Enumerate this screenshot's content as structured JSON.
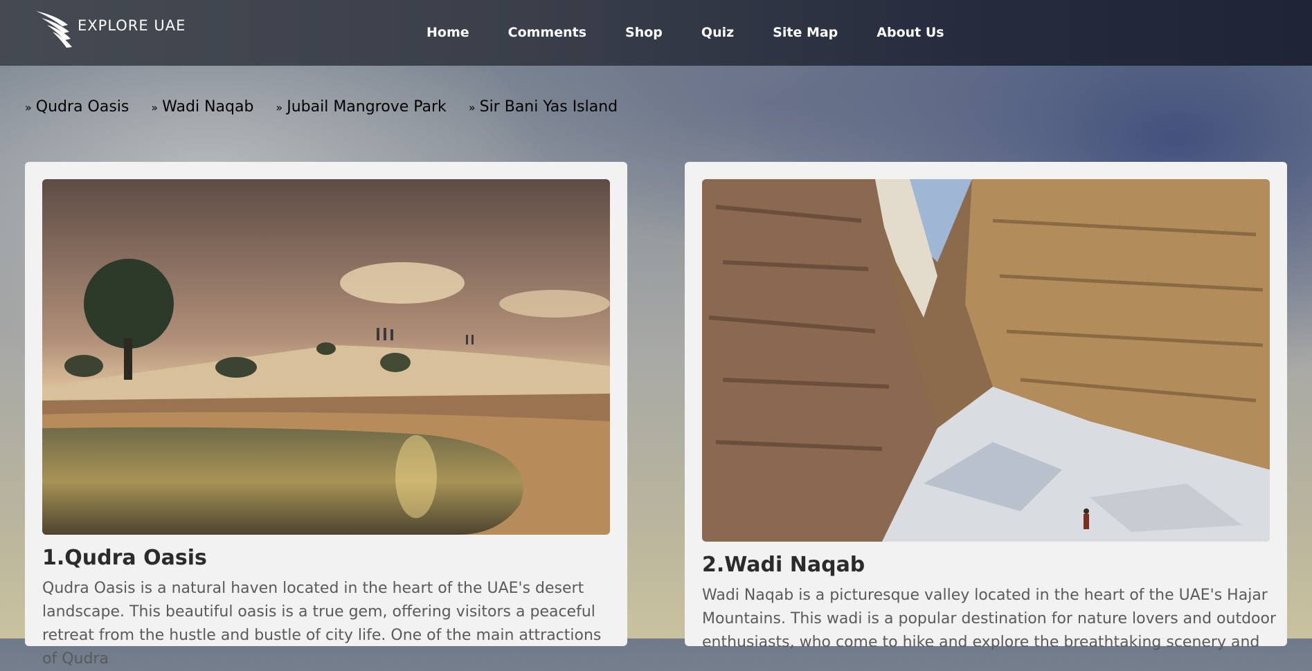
{
  "brand": {
    "name": "EXPLORE UAE",
    "logo_icon": "wing-logo-icon"
  },
  "nav": {
    "items": [
      {
        "label": "Home"
      },
      {
        "label": "Comments"
      },
      {
        "label": "Shop"
      },
      {
        "label": "Quiz"
      },
      {
        "label": "Site Map"
      },
      {
        "label": "About Us"
      }
    ]
  },
  "subnav": {
    "bullet": "»",
    "items": [
      {
        "label": "Qudra Oasis"
      },
      {
        "label": "Wadi Naqab"
      },
      {
        "label": "Jubail Mangrove Park"
      },
      {
        "label": "Sir Bani Yas Island"
      }
    ]
  },
  "cards": [
    {
      "title": "1.Qudra Oasis",
      "image": "desert-oasis-photo",
      "text": "Qudra Oasis is a natural haven located in the heart of the UAE's desert landscape. This beautiful oasis is a true gem, offering visitors a peaceful retreat from the hustle and bustle of city life. One of the main attractions of Qudra"
    },
    {
      "title": "2.Wadi Naqab",
      "image": "canyon-wadi-photo",
      "text": "Wadi Naqab is a picturesque valley located in the heart of the UAE's Hajar Mountains. This wadi is a popular destination for nature lovers and outdoor enthusiasts, who come to hike and explore the breathtaking scenery and"
    }
  ],
  "colors": {
    "navbar": "#2a2f3d",
    "card_bg": "#f2f2f2",
    "title": "#2b2b2b",
    "body_text": "#5a5a5a"
  }
}
